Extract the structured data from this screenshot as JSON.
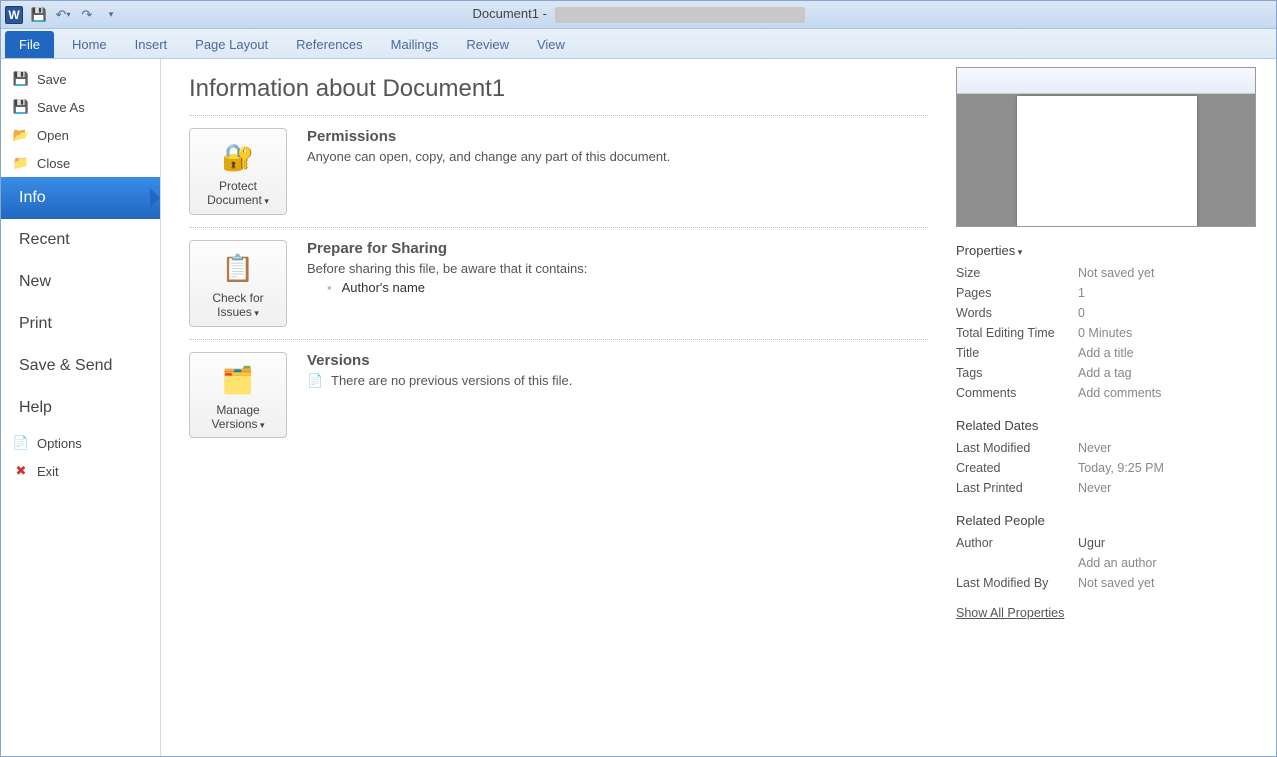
{
  "titlebar": {
    "doc_title": "Document1 -"
  },
  "ribbon": {
    "tabs": [
      "File",
      "Home",
      "Insert",
      "Page Layout",
      "References",
      "Mailings",
      "Review",
      "View"
    ]
  },
  "backstage": {
    "save": "Save",
    "save_as": "Save As",
    "open": "Open",
    "close": "Close",
    "info": "Info",
    "recent": "Recent",
    "new": "New",
    "print": "Print",
    "save_send": "Save & Send",
    "help": "Help",
    "options": "Options",
    "exit": "Exit"
  },
  "info": {
    "heading": "Information about Document1",
    "permissions": {
      "title": "Permissions",
      "desc": "Anyone can open, copy, and change any part of this document.",
      "button": "Protect Document"
    },
    "prepare": {
      "title": "Prepare for Sharing",
      "desc": "Before sharing this file, be aware that it contains:",
      "items": [
        "Author's name"
      ],
      "button": "Check for Issues"
    },
    "versions": {
      "title": "Versions",
      "desc": "There are no previous versions of this file.",
      "button": "Manage Versions"
    }
  },
  "props": {
    "header": "Properties",
    "rows": {
      "size": {
        "k": "Size",
        "v": "Not saved yet"
      },
      "pages": {
        "k": "Pages",
        "v": "1"
      },
      "words": {
        "k": "Words",
        "v": "0"
      },
      "tet": {
        "k": "Total Editing Time",
        "v": "0 Minutes"
      },
      "title": {
        "k": "Title",
        "v": "Add a title"
      },
      "tags": {
        "k": "Tags",
        "v": "Add a tag"
      },
      "comments": {
        "k": "Comments",
        "v": "Add comments"
      }
    },
    "dates_header": "Related Dates",
    "dates": {
      "modified": {
        "k": "Last Modified",
        "v": "Never"
      },
      "created": {
        "k": "Created",
        "v": "Today, 9:25 PM"
      },
      "printed": {
        "k": "Last Printed",
        "v": "Never"
      }
    },
    "people_header": "Related People",
    "people": {
      "author": {
        "k": "Author",
        "v": "Ugur",
        "add": "Add an author"
      },
      "modified_by": {
        "k": "Last Modified By",
        "v": "Not saved yet"
      }
    },
    "show_all": "Show All Properties"
  }
}
